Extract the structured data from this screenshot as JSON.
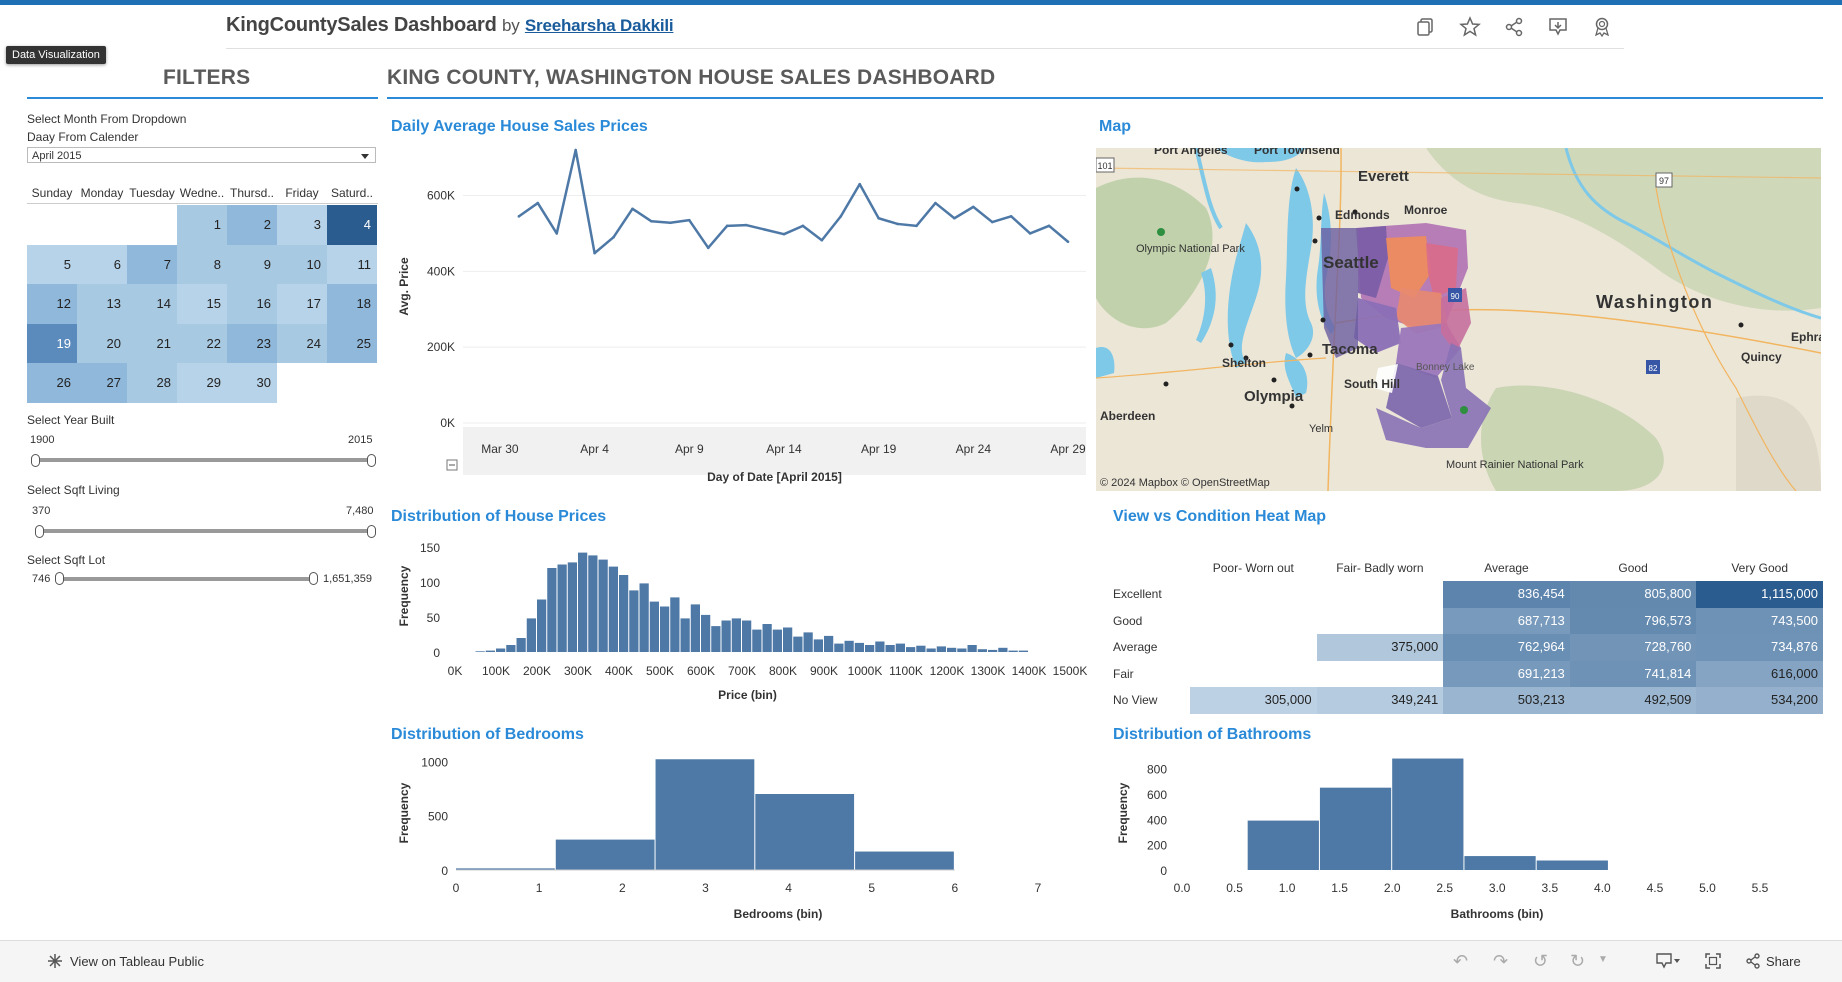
{
  "header": {
    "title": "KingCountySales Dashboard",
    "by": "by",
    "author": "Sreeharsha Dakkili",
    "tooltip": "Data Visualization"
  },
  "toolbar": {
    "icons": [
      "duplicate-icon",
      "star-icon",
      "share-icon",
      "download-icon",
      "ribbon-icon"
    ]
  },
  "filters": {
    "heading": "FILTERS",
    "month_label": "Select Month From Dropdown",
    "day_label": "Daay From Calender",
    "month_value": "April 2015",
    "calendar": {
      "days": [
        "Sunday",
        "Monday",
        "Tuesday",
        "Wedne..",
        "Thursd..",
        "Friday",
        "Saturd.."
      ],
      "cells": [
        {
          "d": "1",
          "col": 3,
          "row": 0,
          "shade": "#a8c9e2"
        },
        {
          "d": "2",
          "col": 4,
          "row": 0,
          "shade": "#8fb8db"
        },
        {
          "d": "3",
          "col": 5,
          "row": 0,
          "shade": "#b7d3e9"
        },
        {
          "d": "4",
          "col": 6,
          "row": 0,
          "shade": "#2b5c90",
          "dark": true
        },
        {
          "d": "5",
          "col": 0,
          "row": 1,
          "shade": "#b7d3e9"
        },
        {
          "d": "6",
          "col": 1,
          "row": 1,
          "shade": "#b7d3e9"
        },
        {
          "d": "7",
          "col": 2,
          "row": 1,
          "shade": "#8fb8db"
        },
        {
          "d": "8",
          "col": 3,
          "row": 1,
          "shade": "#a8c9e2"
        },
        {
          "d": "9",
          "col": 4,
          "row": 1,
          "shade": "#a8c9e2"
        },
        {
          "d": "10",
          "col": 5,
          "row": 1,
          "shade": "#a8c9e2"
        },
        {
          "d": "11",
          "col": 6,
          "row": 1,
          "shade": "#b7d3e9"
        },
        {
          "d": "12",
          "col": 0,
          "row": 2,
          "shade": "#8fb8db"
        },
        {
          "d": "13",
          "col": 1,
          "row": 2,
          "shade": "#a8c9e2"
        },
        {
          "d": "14",
          "col": 2,
          "row": 2,
          "shade": "#a8c9e2"
        },
        {
          "d": "15",
          "col": 3,
          "row": 2,
          "shade": "#b7d3e9"
        },
        {
          "d": "16",
          "col": 4,
          "row": 2,
          "shade": "#a8c9e2"
        },
        {
          "d": "17",
          "col": 5,
          "row": 2,
          "shade": "#b7d3e9"
        },
        {
          "d": "18",
          "col": 6,
          "row": 2,
          "shade": "#8fb8db"
        },
        {
          "d": "19",
          "col": 0,
          "row": 3,
          "shade": "#5b8bbd",
          "dark": true
        },
        {
          "d": "20",
          "col": 1,
          "row": 3,
          "shade": "#a8c9e2"
        },
        {
          "d": "21",
          "col": 2,
          "row": 3,
          "shade": "#a8c9e2"
        },
        {
          "d": "22",
          "col": 3,
          "row": 3,
          "shade": "#a8c9e2"
        },
        {
          "d": "23",
          "col": 4,
          "row": 3,
          "shade": "#8fb8db"
        },
        {
          "d": "24",
          "col": 5,
          "row": 3,
          "shade": "#a8c9e2"
        },
        {
          "d": "25",
          "col": 6,
          "row": 3,
          "shade": "#8fb8db"
        },
        {
          "d": "26",
          "col": 0,
          "row": 4,
          "shade": "#8fb8db"
        },
        {
          "d": "27",
          "col": 1,
          "row": 4,
          "shade": "#8fb8db"
        },
        {
          "d": "28",
          "col": 2,
          "row": 4,
          "shade": "#a8c9e2"
        },
        {
          "d": "29",
          "col": 3,
          "row": 4,
          "shade": "#b7d3e9"
        },
        {
          "d": "30",
          "col": 4,
          "row": 4,
          "shade": "#b7d3e9"
        }
      ]
    },
    "year_label": "Select Year Built",
    "year_min": "1900",
    "year_max": "2015",
    "sqft_living_label": "Select Sqft Living",
    "sqft_living_min": "370",
    "sqft_living_max": "7,480",
    "sqft_lot_label": "Select Sqft Lot",
    "sqft_lot_min": "746",
    "sqft_lot_max": "1,651,359"
  },
  "dashboard": {
    "heading": "KING COUNTY, WASHINGTON HOUSE SALES DASHBOARD"
  },
  "map": {
    "title": "Map",
    "attribution": "© 2024 Mapbox  © OpenStreetMap",
    "labels": [
      "Port Angeles",
      "Port Townsend",
      "Everett",
      "Edmonds",
      "Monroe",
      "Olympic National Park",
      "Seattle",
      "Washington",
      "Tacoma",
      "Shelton",
      "South Hill",
      "Olympia",
      "Aberdeen",
      "Yelm",
      "Mount Rainier National Park",
      "Quincy",
      "Ephrat",
      "Bonney Lake"
    ],
    "road_shields": [
      "101",
      "97",
      "90",
      "82"
    ]
  },
  "chart_data": [
    {
      "type": "line",
      "title": "Daily Average House Sales Prices",
      "xlabel": "Day of Date [April 2015]",
      "ylabel": "Avg. Price",
      "x_ticks": [
        "Mar 30",
        "Apr 4",
        "Apr 9",
        "Apr 14",
        "Apr 19",
        "Apr 24",
        "Apr 29"
      ],
      "y_ticks": [
        "0K",
        "200K",
        "400K",
        "600K"
      ],
      "ylim": [
        0,
        720000
      ],
      "x": [
        "Apr 1",
        "Apr 2",
        "Apr 3",
        "Apr 4",
        "Apr 5",
        "Apr 6",
        "Apr 7",
        "Apr 8",
        "Apr 9",
        "Apr 10",
        "Apr 11",
        "Apr 12",
        "Apr 13",
        "Apr 14",
        "Apr 15",
        "Apr 16",
        "Apr 17",
        "Apr 18",
        "Apr 19",
        "Apr 20",
        "Apr 21",
        "Apr 22",
        "Apr 23",
        "Apr 24",
        "Apr 25",
        "Apr 26",
        "Apr 27",
        "Apr 28",
        "Apr 29",
        "Apr 30"
      ],
      "values": [
        545000,
        580000,
        500000,
        720000,
        448000,
        490000,
        565000,
        532000,
        528000,
        535000,
        462000,
        520000,
        522000,
        510000,
        498000,
        520000,
        482000,
        545000,
        630000,
        540000,
        525000,
        520000,
        580000,
        540000,
        570000,
        530000,
        545000,
        500000,
        520000,
        478000
      ]
    },
    {
      "type": "bar",
      "title": "Distribution of House Prices",
      "xlabel": "Price (bin)",
      "ylabel": "Frequency",
      "x_ticks": [
        "0K",
        "100K",
        "200K",
        "300K",
        "400K",
        "500K",
        "600K",
        "700K",
        "800K",
        "900K",
        "1000K",
        "1100K",
        "1200K",
        "1300K",
        "1400K",
        "1500K"
      ],
      "y_ticks": [
        "0",
        "50",
        "100",
        "150"
      ],
      "ylim": [
        0,
        160
      ],
      "bin_width": 25000,
      "bin_start": 50000,
      "values": [
        1,
        2,
        5,
        10,
        20,
        48,
        75,
        120,
        125,
        128,
        142,
        138,
        132,
        122,
        110,
        88,
        98,
        72,
        65,
        78,
        48,
        68,
        53,
        37,
        45,
        48,
        45,
        32,
        40,
        32,
        35,
        22,
        28,
        18,
        23,
        12,
        16,
        13,
        10,
        15,
        10,
        12,
        7,
        9,
        5,
        8,
        6,
        5,
        10,
        4,
        3,
        6,
        2,
        2
      ]
    },
    {
      "type": "heatmap",
      "title": "View vs Condition Heat Map",
      "columns": [
        "Poor- Worn out",
        "Fair- Badly worn",
        "Average",
        "Good",
        "Very Good"
      ],
      "rows": [
        "Excellent",
        "Good",
        "Average",
        "Fair",
        "No View"
      ],
      "values": [
        [
          null,
          null,
          836454,
          805800,
          1115000
        ],
        [
          null,
          null,
          687713,
          796573,
          743500
        ],
        [
          null,
          375000,
          762964,
          728760,
          734876
        ],
        [
          null,
          null,
          691213,
          741814,
          616000
        ],
        [
          305000,
          349241,
          503213,
          492509,
          534200
        ]
      ],
      "labels": [
        [
          "",
          "",
          "836,454",
          "805,800",
          "1,115,000"
        ],
        [
          "",
          "",
          "687,713",
          "796,573",
          "743,500"
        ],
        [
          "",
          "375,000",
          "762,964",
          "728,760",
          "734,876"
        ],
        [
          "",
          "",
          "691,213",
          "741,814",
          "616,000"
        ],
        [
          "305,000",
          "349,241",
          "503,213",
          "492,509",
          "534,200"
        ]
      ],
      "vrange": [
        300000,
        1115000
      ]
    },
    {
      "type": "bar",
      "title": "Distribution of Bedrooms",
      "xlabel": "Bedrooms (bin)",
      "ylabel": "Frequency",
      "x_ticks": [
        "0",
        "1",
        "2",
        "3",
        "4",
        "5",
        "6",
        "7"
      ],
      "y_ticks": [
        "0",
        "500",
        "1000"
      ],
      "ylim": [
        0,
        1050
      ],
      "bin_edges": [
        0,
        1.2,
        2.4,
        3.6,
        4.8,
        6.0
      ],
      "values": [
        15,
        280,
        1020,
        700,
        170
      ]
    },
    {
      "type": "bar",
      "title": "Distribution of Bathrooms",
      "xlabel": "Bathrooms (bin)",
      "ylabel": "Frequency",
      "x_ticks": [
        "0.0",
        "0.5",
        "1.0",
        "1.5",
        "2.0",
        "2.5",
        "3.0",
        "3.5",
        "4.0",
        "4.5",
        "5.0",
        "5.5"
      ],
      "y_ticks": [
        "0",
        "200",
        "400",
        "600",
        "800"
      ],
      "ylim": [
        0,
        900
      ],
      "bin_edges": [
        0.625,
        1.3125,
        2.0,
        2.6875,
        3.375,
        4.0625
      ],
      "values": [
        390,
        650,
        880,
        110,
        75
      ]
    }
  ],
  "footer": {
    "view_on": "View on Tableau Public",
    "share": "Share"
  },
  "colors": {
    "accent": "#2a8ad8",
    "bar": "#4e79a7",
    "line": "#4e79a7",
    "top_stripe": "#1f6fb5"
  }
}
